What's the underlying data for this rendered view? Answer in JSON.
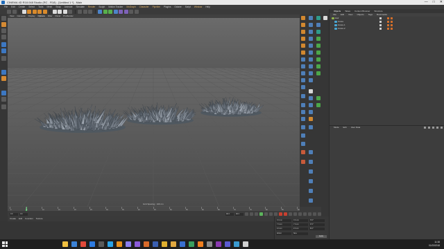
{
  "window": {
    "title": "CINEMA 4D R18.048 Studio (RC - R18) - [Untitled 1 *] - Main",
    "controls": [
      "—",
      "□",
      "✕"
    ]
  },
  "menubar": {
    "items": [
      "File",
      "Edit",
      "Create",
      "Select",
      "Tools",
      "Mesh",
      "Snap",
      "Animate",
      "Simulate",
      "Render",
      "Sculpt",
      "Motion Tracker",
      "MoGraph",
      "Character",
      "Pipeline",
      "Plugins",
      "Octane",
      "Script",
      "Window",
      "Help"
    ],
    "highlighted": [
      "Render",
      "MoGraph",
      "Character",
      "Pipeline",
      "Window"
    ]
  },
  "viewport": {
    "menu": [
      "View",
      "Cameras",
      "Display",
      "Options",
      "Filter",
      "Panel",
      "ProRender"
    ],
    "active_menu": "Options",
    "label": "Grid Spacing : 100 cm"
  },
  "object_manager": {
    "tabs": [
      "Objects",
      "Takes",
      "Content Browser",
      "Structure"
    ],
    "active_tab": "Objects",
    "menu": [
      "File",
      "Edit",
      "View",
      "Objects",
      "Tags",
      "Bookmarks"
    ],
    "objects": [
      "Hair",
      "Grass",
      "Grass.1",
      "Grass.2"
    ]
  },
  "attribute_manager": {
    "tabs": [
      "Attributes",
      "Layers"
    ],
    "menu": [
      "Mode",
      "Edit",
      "User Data"
    ]
  },
  "timeline": {
    "ruler_labels": [
      "0",
      "5",
      "10",
      "15",
      "20",
      "25",
      "30",
      "35",
      "40",
      "45",
      "50",
      "55",
      "60",
      "65",
      "70",
      "75",
      "80",
      "85",
      "90"
    ],
    "current_frame": 5,
    "start_field": "0 F",
    "current_field": "0 F",
    "end_field": "90 F",
    "end_field2": "90 F"
  },
  "material_manager": {
    "menu": [
      "Create",
      "Edit",
      "Function",
      "Texture"
    ]
  },
  "coordinates": {
    "rows": [
      [
        "X 0 cm",
        "X 0 cm",
        "H 0°"
      ],
      [
        "Y 0 cm",
        "Y 0 cm",
        "P 0°"
      ],
      [
        "Z 0 cm",
        "Z 0 cm",
        "B 0°"
      ]
    ],
    "mode_label": "World",
    "scale_label": "Size",
    "apply_label": "Apply"
  },
  "taskbar": {
    "time": "11:38",
    "date": "01/03/2018",
    "apps": [
      {
        "name": "file-explorer-icon",
        "color": "#f0c040"
      },
      {
        "name": "browser-icon",
        "color": "#3b82d6"
      },
      {
        "name": "chrome-icon",
        "color": "#e04a3a"
      },
      {
        "name": "mail-icon",
        "color": "#2d7be0"
      },
      {
        "name": "store-icon",
        "color": "#5a5a5a"
      },
      {
        "name": "photoshop-icon",
        "color": "#2aa3e8"
      },
      {
        "name": "illustrator-icon",
        "color": "#e8901a"
      },
      {
        "name": "after-effects-icon",
        "color": "#8a7ff0"
      },
      {
        "name": "premiere-icon",
        "color": "#8a5ad8"
      },
      {
        "name": "media-player-icon",
        "color": "#d86a2a"
      },
      {
        "name": "cinema4d-icon",
        "color": "#3a5fb0"
      },
      {
        "name": "music-icon",
        "color": "#e0b030"
      },
      {
        "name": "folder-icon",
        "color": "#e0a840"
      },
      {
        "name": "word-icon",
        "color": "#3a6fd0"
      },
      {
        "name": "excel-icon",
        "color": "#3aa060"
      },
      {
        "name": "vlc-icon",
        "color": "#f08020"
      },
      {
        "name": "settings-icon",
        "color": "#8a8a8a"
      },
      {
        "name": "onenote-icon",
        "color": "#8a3ab0"
      },
      {
        "name": "teams-icon",
        "color": "#5a5ad0"
      },
      {
        "name": "app-20-icon",
        "color": "#3a9ad0"
      },
      {
        "name": "app-21-icon",
        "color": "#d0d0d0"
      }
    ]
  }
}
